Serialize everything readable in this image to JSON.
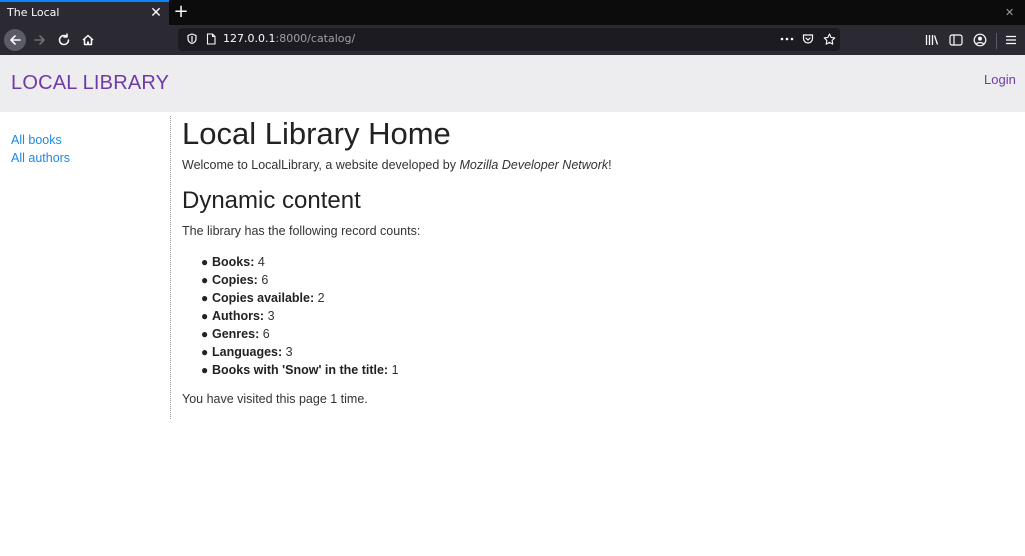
{
  "browser": {
    "tab_title": "The Local",
    "url_host": "127.0.0.1",
    "url_rest": ":8000/catalog/",
    "icons": [
      "back-arrow-icon",
      "forward-arrow-icon",
      "reload-icon",
      "home-icon",
      "shield-icon",
      "page-icon",
      "more-icon",
      "pocket-icon",
      "star-icon",
      "library-icon",
      "sidebar-icon",
      "account-icon",
      "menu-icon"
    ],
    "colors": {
      "tab_accent": "#0a84ff",
      "toolbar_bg": "#2b2a33",
      "urlbar_bg": "#1c1b22"
    }
  },
  "header": {
    "site_title": "LOCAL LIBRARY",
    "login": "Login"
  },
  "sidebar": {
    "links": [
      "All books",
      "All authors"
    ]
  },
  "main": {
    "title": "Local Library Home",
    "welcome_prefix": "Welcome to LocalLibrary, a website developed by ",
    "welcome_em": "Mozilla Developer Network",
    "welcome_suffix": "!",
    "section_title": "Dynamic content",
    "record_intro": "The library has the following record counts:",
    "counts": [
      {
        "label": "Books:",
        "value": "4"
      },
      {
        "label": "Copies:",
        "value": "6"
      },
      {
        "label": "Copies available:",
        "value": "2"
      },
      {
        "label": "Authors:",
        "value": "3"
      },
      {
        "label": "Genres:",
        "value": "6"
      },
      {
        "label": "Languages:",
        "value": "3"
      },
      {
        "label": "Books with 'Snow' in the title:",
        "value": "1"
      }
    ],
    "visits": "You have visited this page 1 time."
  },
  "colors": {
    "link_purple": "#6f3aa8",
    "link_blue": "#1e88e5",
    "header_bg": "#edecef"
  }
}
